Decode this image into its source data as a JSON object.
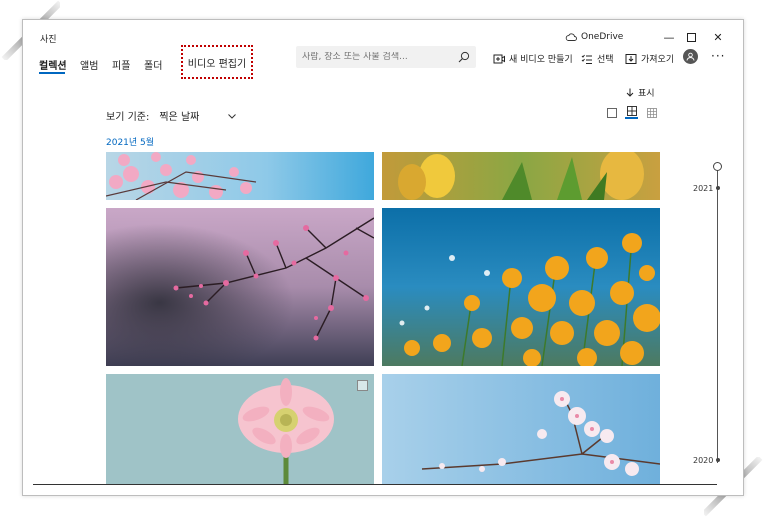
{
  "window": {
    "title": "사진"
  },
  "titlebar": {
    "onedrive_label": "OneDrive",
    "minimize": "—",
    "maximize": "☐",
    "close": "✕"
  },
  "nav": {
    "tabs": [
      {
        "label": "컬렉션",
        "active": true
      },
      {
        "label": "앨범",
        "active": false
      },
      {
        "label": "피플",
        "active": false
      },
      {
        "label": "폴더",
        "active": false
      }
    ],
    "video_editor_label": "비디오 편집기"
  },
  "search": {
    "placeholder": "사람, 장소 또는 사물 검색..."
  },
  "actions": {
    "new_video_label": "새 비디오 만들기",
    "select_label": "선택",
    "import_label": "가져오기",
    "more_label": "···"
  },
  "view": {
    "show_label": "표시",
    "sort_prefix": "보기 기준:",
    "sort_value": "찍은 날짜"
  },
  "content": {
    "month_label": "2021년 5월"
  },
  "timeline": {
    "year_top": "2021",
    "year_bottom": "2020"
  },
  "colors": {
    "accent": "#0067c0",
    "highlight_border": "#c00000"
  },
  "icons": {
    "onedrive": "cloud-icon",
    "search": "search-icon",
    "new_video": "video-add-icon",
    "select": "checklist-icon",
    "import": "import-icon",
    "show": "arrow-down-icon"
  }
}
